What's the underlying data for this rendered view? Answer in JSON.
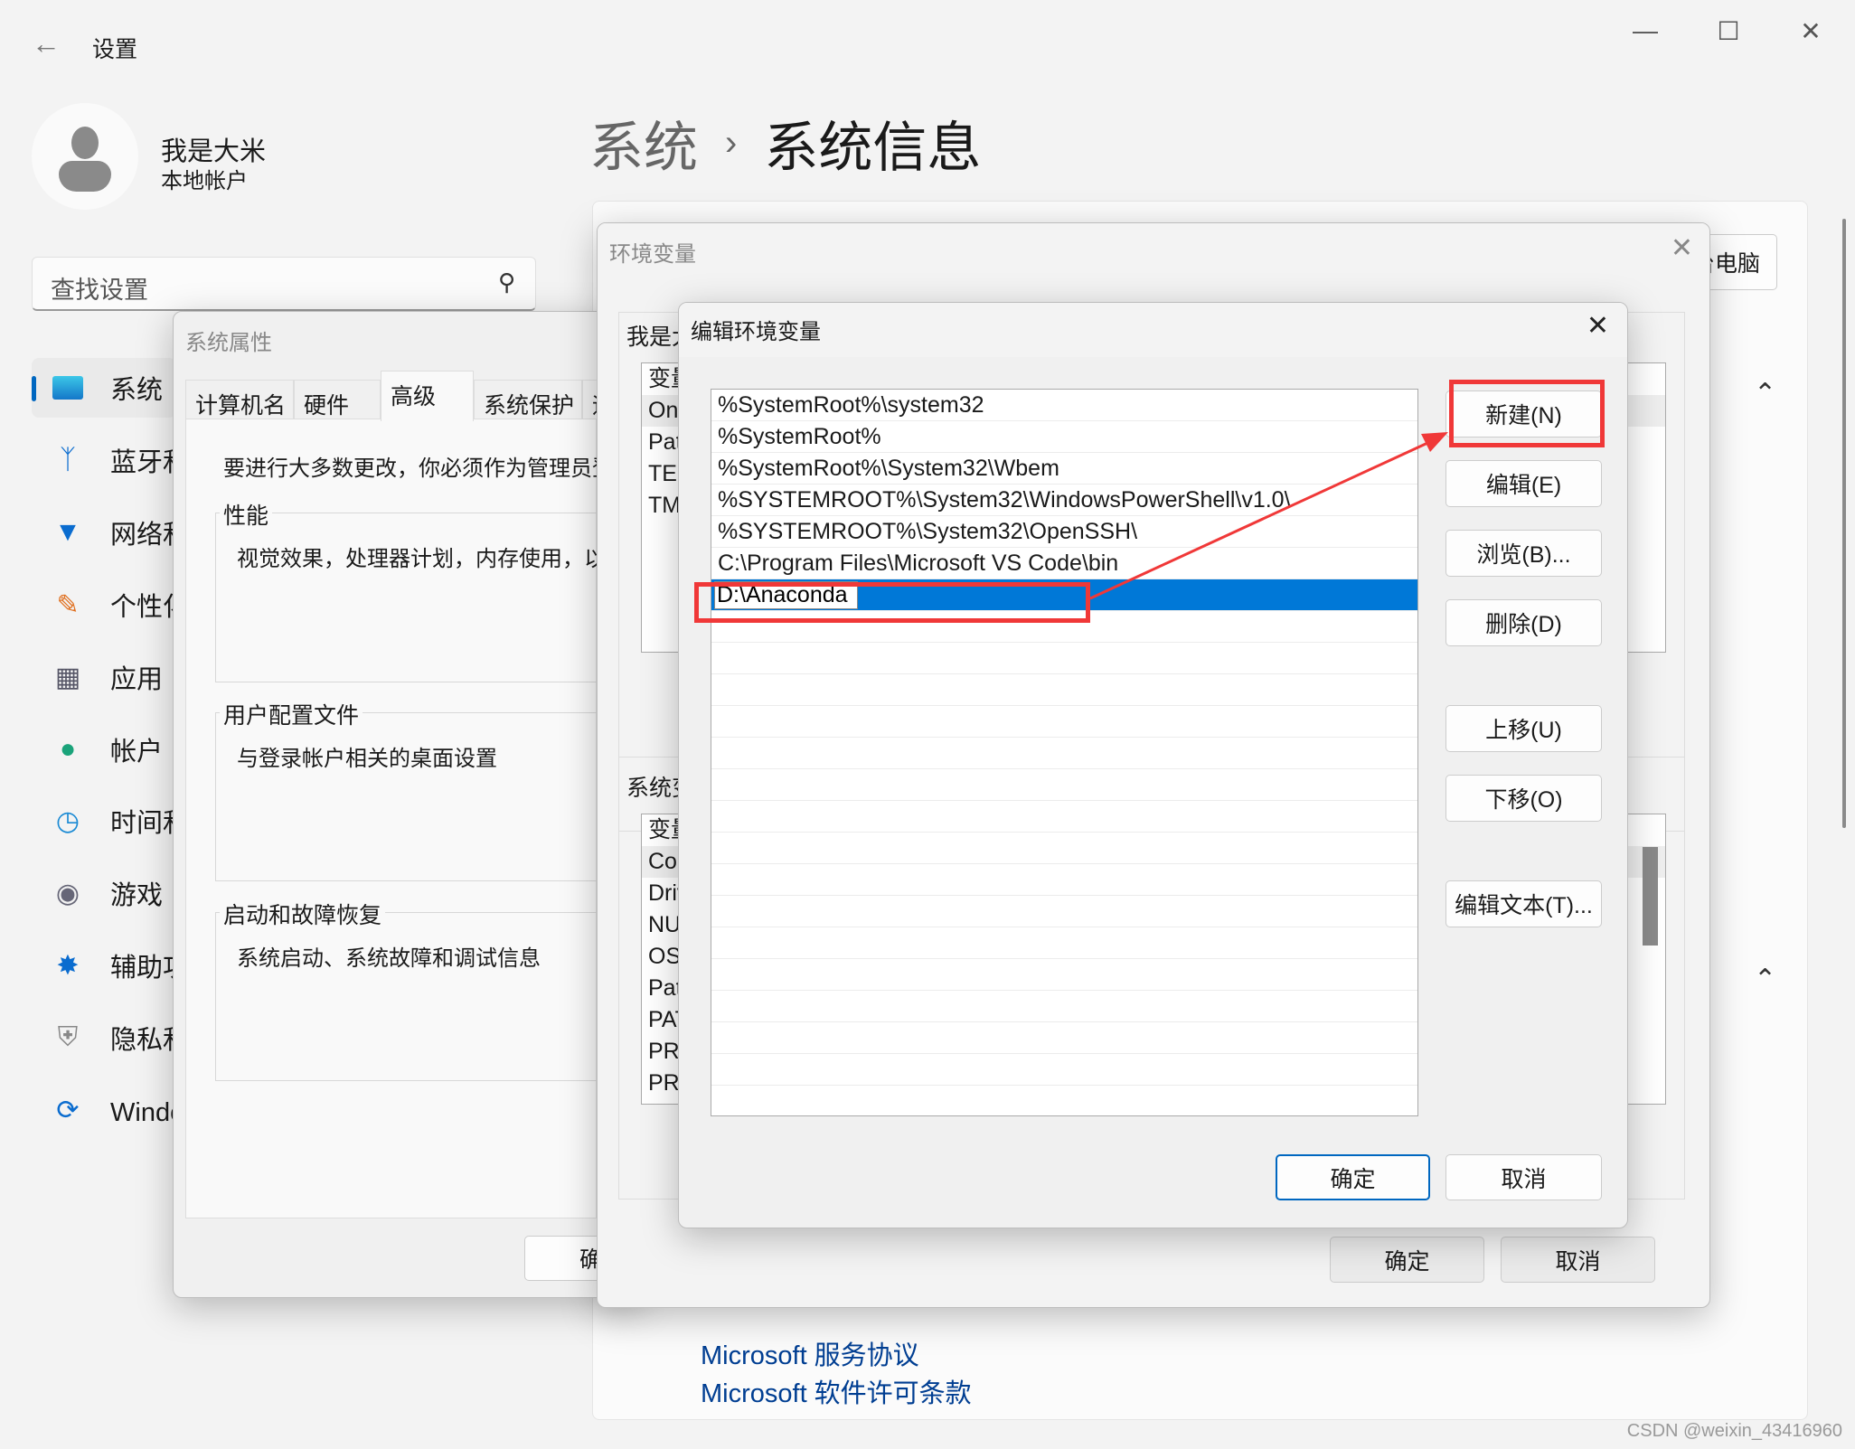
{
  "settings": {
    "back_icon": "arrow-left-icon",
    "title": "设置",
    "user_name": "我是大米",
    "account_type": "本地帐户",
    "breadcrumb": {
      "parent": "系统",
      "separator": "›",
      "current": "系统信息"
    },
    "search_placeholder": "查找设置",
    "sidebar": [
      {
        "label": "系统",
        "icon": "monitor-icon"
      },
      {
        "label": "蓝牙和设备",
        "icon": "bluetooth-icon"
      },
      {
        "label": "网络和 Internet",
        "icon": "wifi-icon"
      },
      {
        "label": "个性化",
        "icon": "brush-icon"
      },
      {
        "label": "应用",
        "icon": "apps-icon"
      },
      {
        "label": "帐户",
        "icon": "person-icon"
      },
      {
        "label": "时间和语言",
        "icon": "globe-clock-icon"
      },
      {
        "label": "游戏",
        "icon": "gamepad-icon"
      },
      {
        "label": "辅助功能",
        "icon": "accessibility-icon"
      },
      {
        "label": "隐私和安全性",
        "icon": "shield-icon"
      },
      {
        "label": "Windows 更新",
        "icon": "update-icon"
      }
    ],
    "rename_button": "重命名这台电脑",
    "links": [
      "Microsoft 服务协议",
      "Microsoft 软件许可条款"
    ]
  },
  "sysprops": {
    "title": "系统属性",
    "tabs": [
      "计算机名",
      "硬件",
      "高级",
      "系统保护",
      "远程"
    ],
    "active_tab": "高级",
    "admin_note": "要进行大多数更改，你必须作为管理员登录。",
    "groups": [
      {
        "label": "性能",
        "desc": "视觉效果，处理器计划，内存使用，以及虚拟内存"
      },
      {
        "label": "用户配置文件",
        "desc": "与登录帐户相关的桌面设置"
      },
      {
        "label": "启动和故障恢复",
        "desc": "系统启动、系统故障和调试信息"
      }
    ],
    "ok": "确定"
  },
  "envvars": {
    "title": "环境变量",
    "user_label": "我是大米 的用户变量(U)",
    "user_rows": [
      "变量",
      "OneDrive",
      "Path",
      "TEMP",
      "TMP"
    ],
    "system_label": "系统变量(S)",
    "system_rows": [
      "变量",
      "ComSpec",
      "DriverData",
      "NUMBER_OF_PROCESSORS",
      "OS",
      "Path",
      "PATHEXT",
      "PROCESSOR_ARCHITECTURE",
      "PROCESSOR_IDENTIFIER"
    ],
    "ok": "确定",
    "cancel": "取消"
  },
  "editenv": {
    "title": "编辑环境变量",
    "entries": [
      "%SystemRoot%\\system32",
      "%SystemRoot%",
      "%SystemRoot%\\System32\\Wbem",
      "%SYSTEMROOT%\\System32\\WindowsPowerShell\\v1.0\\",
      "%SYSTEMROOT%\\System32\\OpenSSH\\",
      "C:\\Program Files\\Microsoft VS Code\\bin"
    ],
    "editing_value": "D:\\Anaconda",
    "buttons": {
      "new": "新建(N)",
      "edit": "编辑(E)",
      "browse": "浏览(B)...",
      "delete": "删除(D)",
      "up": "上移(U)",
      "down": "下移(O)",
      "edit_text": "编辑文本(T)..."
    },
    "ok": "确定",
    "cancel": "取消"
  },
  "annotation_color": "#f03838",
  "accent": "#0078d7",
  "watermark": "CSDN @weixin_43416960"
}
